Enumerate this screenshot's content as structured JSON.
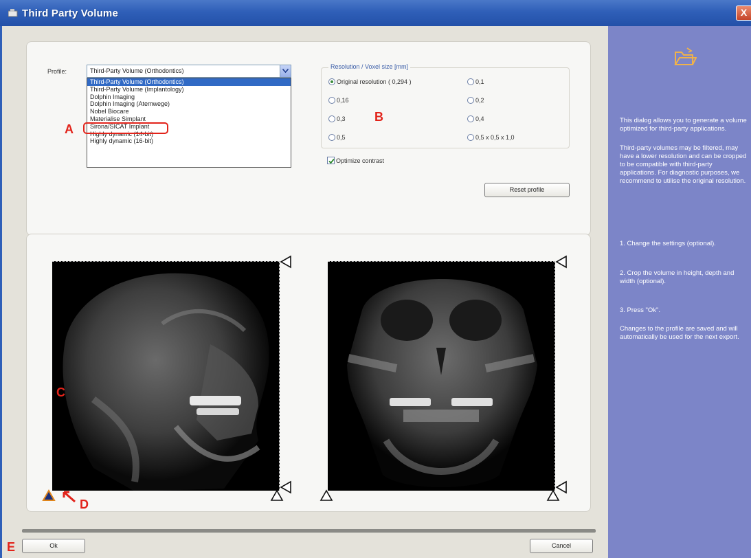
{
  "window": {
    "title": "Third Party Volume",
    "close_glyph": "X"
  },
  "profile": {
    "label": "Profile:",
    "selected_value": "Third-Party Volume (Orthodontics)",
    "options": [
      "Third-Party Volume (Orthodontics)",
      "Third-Party Volume (Implantology)",
      "Dolphin Imaging",
      "Dolphin Imaging (Atemwege)",
      "Nobel Biocare",
      "Materialise Simplant",
      "Sirona/SICAT Implant",
      "Highly dynamic (14-bit)",
      "Highly dynamic (16-bit)"
    ],
    "highlighted_index": 0
  },
  "resolution": {
    "legend": "Resolution / Voxel size [mm]",
    "options": [
      {
        "label": "Original resolution ( 0,294 )",
        "checked": true
      },
      {
        "label": "0,1",
        "checked": false
      },
      {
        "label": "0,16",
        "checked": false
      },
      {
        "label": "0,2",
        "checked": false
      },
      {
        "label": "0,3",
        "checked": false
      },
      {
        "label": "0,4",
        "checked": false
      },
      {
        "label": "0,5",
        "checked": false
      },
      {
        "label": "0,5 x 0,5 x 1,0",
        "checked": false
      }
    ]
  },
  "optimize_contrast": {
    "label": "Optimize contrast",
    "checked": true
  },
  "buttons": {
    "reset_profile": "Reset profile",
    "ok": "Ok",
    "cancel": "Cancel"
  },
  "help": {
    "icon": "folder-open-icon",
    "paragraphs": [
      "This dialog allows you to generate a volume optimized for third-party applications.",
      "Third-party volumes may be filtered, may have a lower resolution and can be cropped to be compatible with third-party applications. For diagnostic purposes, we recommend to utilise the original resolution.",
      "1. Change the settings (optional).",
      "2. Crop the volume in height, depth and width (optional).",
      "3. Press \"Ok\".",
      "Changes to the profile are saved and will automatically be used for the next export."
    ]
  },
  "annotations": {
    "a": "A",
    "b": "B",
    "c": "C",
    "d": "D",
    "e": "E"
  },
  "colors": {
    "titlebar": "#2f5fb8",
    "help_panel": "#7c85c8",
    "annotation": "#e2231a",
    "selection": "#316ac5"
  }
}
